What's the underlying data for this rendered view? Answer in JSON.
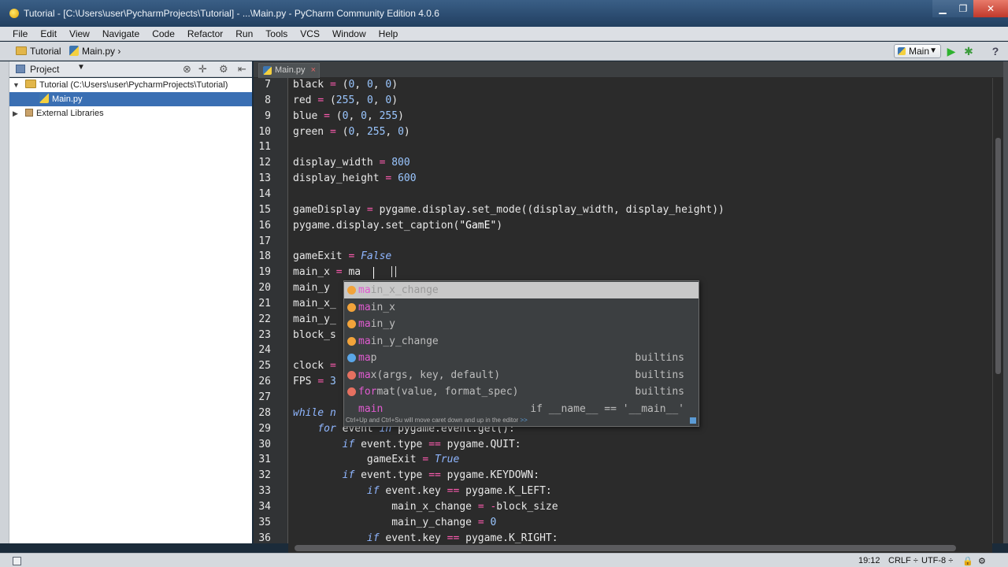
{
  "window": {
    "title": "Tutorial - [C:\\Users\\user\\PycharmProjects\\Tutorial] - ...\\Main.py - PyCharm Community Edition 4.0.6",
    "min_icon": "minimize-icon",
    "max_icon": "maximize-icon",
    "close_icon": "close-icon",
    "min_glyph": "▁",
    "max_glyph": "❐",
    "close_glyph": "✕"
  },
  "menu": [
    "File",
    "Edit",
    "View",
    "Navigate",
    "Code",
    "Refactor",
    "Run",
    "Tools",
    "VCS",
    "Window",
    "Help"
  ],
  "navbar": {
    "crumb_project": "Tutorial",
    "crumb_file": "Main.py",
    "run_config": "Main",
    "run_glyph": "▶",
    "debug_glyph": "✱",
    "help_glyph": "?"
  },
  "project_panel": {
    "header": "Project",
    "root_label": "Tutorial (C:\\Users\\user\\PycharmProjects\\Tutorial)",
    "file_label": "Main.py",
    "ext_label": "External Libraries",
    "expand_glyph": "▼",
    "collapse_glyph": "▶",
    "header_buttons": [
      "⊗",
      "✛",
      "⚙",
      "⇤"
    ]
  },
  "editor": {
    "tab_label": "Main.py",
    "tab_close": "×",
    "lines": [
      {
        "no": "7",
        "html": "black <span class=\"op\">=</span> (<span class=\"num\">0</span>, <span class=\"num\">0</span>, <span class=\"num\">0</span>)"
      },
      {
        "no": "8",
        "html": "red <span class=\"op\">=</span> (<span class=\"num\">255</span>, <span class=\"num\">0</span>, <span class=\"num\">0</span>)"
      },
      {
        "no": "9",
        "html": "blue <span class=\"op\">=</span> (<span class=\"num\">0</span>, <span class=\"num\">0</span>, <span class=\"num\">255</span>)"
      },
      {
        "no": "10",
        "html": "green <span class=\"op\">=</span> (<span class=\"num\">0</span>, <span class=\"num\">255</span>, <span class=\"num\">0</span>)"
      },
      {
        "no": "11",
        "html": ""
      },
      {
        "no": "12",
        "html": "display_width <span class=\"op\">=</span> <span class=\"num\">800</span>"
      },
      {
        "no": "13",
        "html": "display_height <span class=\"op\">=</span> <span class=\"num\">600</span>"
      },
      {
        "no": "14",
        "html": ""
      },
      {
        "no": "15",
        "html": "gameDisplay <span class=\"op\">=</span> pygame.display.set_mode((display_width, display_height))"
      },
      {
        "no": "16",
        "html": "pygame.display.set_caption(<span class=\"str\">\"GamE\"</span>)"
      },
      {
        "no": "17",
        "html": ""
      },
      {
        "no": "18",
        "html": "gameExit <span class=\"op\">=</span> <span class=\"builtin-kw\">False</span>"
      },
      {
        "no": "19",
        "html": "main_x <span class=\"op\">=</span> ma"
      },
      {
        "no": "20",
        "html": "main_y "
      },
      {
        "no": "21",
        "html": "main_x_"
      },
      {
        "no": "22",
        "html": "main_y_"
      },
      {
        "no": "23",
        "html": "block_s"
      },
      {
        "no": "24",
        "html": ""
      },
      {
        "no": "25",
        "html": "clock <span class=\"op\">=</span>"
      },
      {
        "no": "26",
        "html": "FPS <span class=\"op\">=</span> <span class=\"num\">3</span>"
      },
      {
        "no": "27",
        "html": ""
      },
      {
        "no": "28",
        "html": "<span class=\"builtin-kw\">while</span> <span class=\"builtin-kw\">n</span>"
      },
      {
        "no": "29",
        "html": "    <span class=\"builtin-kw\">for</span> event <span class=\"builtin-kw\">in</span> pygame.event.get():"
      },
      {
        "no": "30",
        "html": "        <span class=\"builtin-kw\">if</span> event.type <span class=\"op\">==</span> pygame.QUIT:"
      },
      {
        "no": "31",
        "html": "            gameExit <span class=\"op\">=</span> <span class=\"builtin-kw\">True</span>"
      },
      {
        "no": "32",
        "html": "        <span class=\"builtin-kw\">if</span> event.type <span class=\"op\">==</span> pygame.KEYDOWN:"
      },
      {
        "no": "33",
        "html": "            <span class=\"builtin-kw\">if</span> event.key <span class=\"op\">==</span> pygame.K_LEFT:"
      },
      {
        "no": "34",
        "html": "                main_x_change <span class=\"op\">=</span> <span class=\"op\">-</span>block_size"
      },
      {
        "no": "35",
        "html": "                main_y_change <span class=\"op\">=</span> <span class=\"num\">0</span>"
      },
      {
        "no": "36",
        "html": "            <span class=\"builtin-kw\">if</span> event.key <span class=\"op\">==</span> pygame.K_RIGHT:"
      }
    ],
    "current_line": "19"
  },
  "autocomplete": {
    "items": [
      {
        "kind": "var",
        "match": "ma",
        "rest": "in_x_change",
        "tail": "",
        "source": "",
        "selected": true
      },
      {
        "kind": "var",
        "match": "ma",
        "rest": "in_x",
        "tail": "",
        "source": "",
        "selected": false
      },
      {
        "kind": "var",
        "match": "ma",
        "rest": "in_y",
        "tail": "",
        "source": "",
        "selected": false
      },
      {
        "kind": "var",
        "match": "ma",
        "rest": "in_y_change",
        "tail": "",
        "source": "",
        "selected": false
      },
      {
        "kind": "fn",
        "match": "ma",
        "rest": "p",
        "tail": "",
        "source": "builtins",
        "selected": false
      },
      {
        "kind": "met",
        "match": "ma",
        "rest": "x",
        "tail": "(args, key, default)",
        "source": "builtins",
        "selected": false
      },
      {
        "kind": "met",
        "match": "for",
        "rest": "mat",
        "tail": "(value, format_spec)",
        "source": "builtins",
        "selected": false
      },
      {
        "kind": "none",
        "match": "main",
        "rest": "",
        "tail": "",
        "source": "if __name__ == '__main__'",
        "selected": false
      }
    ],
    "hint": "Ctrl+Up and Ctrl+Su will move caret down and up in the editor",
    "hint_link": ">>"
  },
  "status": {
    "position": "19:12",
    "line_sep": "CRLF ÷",
    "encoding": "UTF-8 ÷",
    "lock_glyph": "🔒",
    "extra_glyph": "⚙"
  },
  "colors": {
    "keyword": "#8fb6ff",
    "number": "#9ac6ff",
    "operator": "#ff5bb0",
    "selection": "#3a6fb3"
  }
}
